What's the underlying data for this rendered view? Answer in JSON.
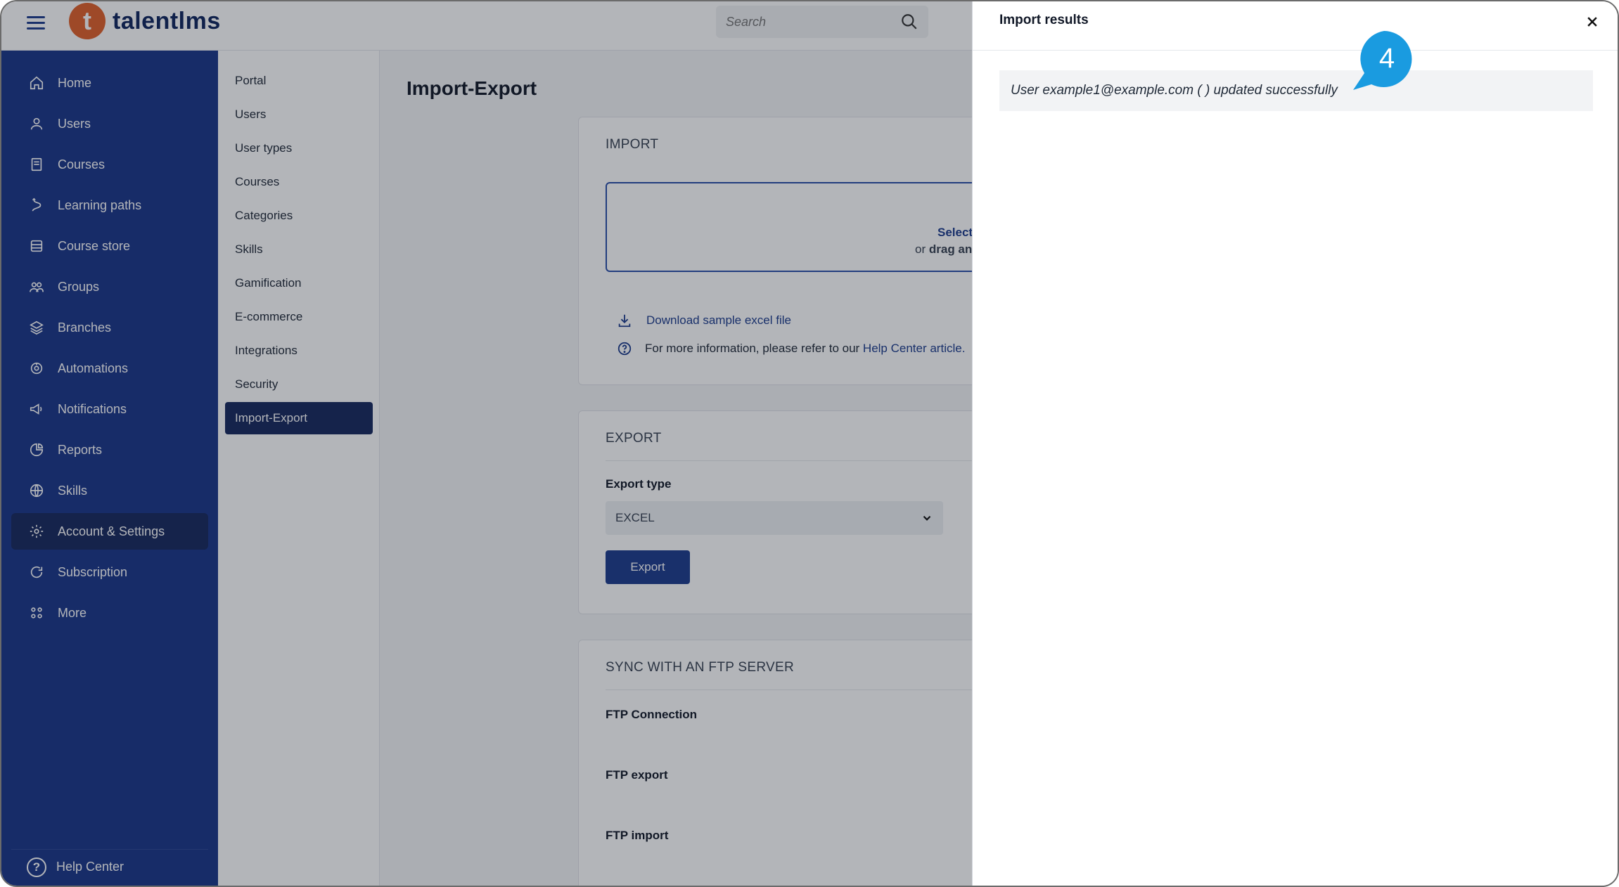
{
  "app": {
    "brand": "talentlms",
    "logo_letter": "t"
  },
  "search": {
    "placeholder": "Search"
  },
  "sidebar": {
    "items": [
      {
        "label": "Home",
        "icon": "home-icon"
      },
      {
        "label": "Users",
        "icon": "user-icon"
      },
      {
        "label": "Courses",
        "icon": "book-icon"
      },
      {
        "label": "Learning paths",
        "icon": "path-icon"
      },
      {
        "label": "Course store",
        "icon": "store-icon"
      },
      {
        "label": "Groups",
        "icon": "group-icon"
      },
      {
        "label": "Branches",
        "icon": "layers-icon"
      },
      {
        "label": "Automations",
        "icon": "automation-icon"
      },
      {
        "label": "Notifications",
        "icon": "megaphone-icon"
      },
      {
        "label": "Reports",
        "icon": "pie-chart-icon"
      },
      {
        "label": "Skills",
        "icon": "globe-icon"
      },
      {
        "label": "Account & Settings",
        "icon": "gear-icon",
        "active": true
      },
      {
        "label": "Subscription",
        "icon": "refresh-icon"
      },
      {
        "label": "More",
        "icon": "grid-icon"
      }
    ],
    "help_center": "Help Center"
  },
  "submenu": {
    "items": [
      "Portal",
      "Users",
      "User types",
      "Courses",
      "Categories",
      "Skills",
      "Gamification",
      "E-commerce",
      "Integrations",
      "Security",
      "Import-Export"
    ],
    "active": "Import-Export"
  },
  "main": {
    "title": "Import-Export",
    "import": {
      "title": "IMPORT",
      "dropzone_line1": "Select",
      "dropzone_line2_prefix": "or",
      "dropzone_line2_bold": "drag an",
      "download_link": "Download sample excel file",
      "info_text": "For more information, please refer to our",
      "info_link": "Help Center article."
    },
    "export": {
      "title": "EXPORT",
      "type_label": "Export type",
      "type_value": "EXCEL",
      "button": "Export"
    },
    "ftp": {
      "title": "SYNC WITH AN FTP SERVER",
      "connection": "FTP Connection",
      "export": "FTP export",
      "import": "FTP import"
    }
  },
  "panel": {
    "title": "Import results",
    "result": "User example1@example.com ( ) updated successfully",
    "callout_number": "4"
  },
  "colors": {
    "sidebar": "#1a3588",
    "accent": "#1c3c8c",
    "logo": "#e0602a",
    "callout": "#1a9be0"
  }
}
